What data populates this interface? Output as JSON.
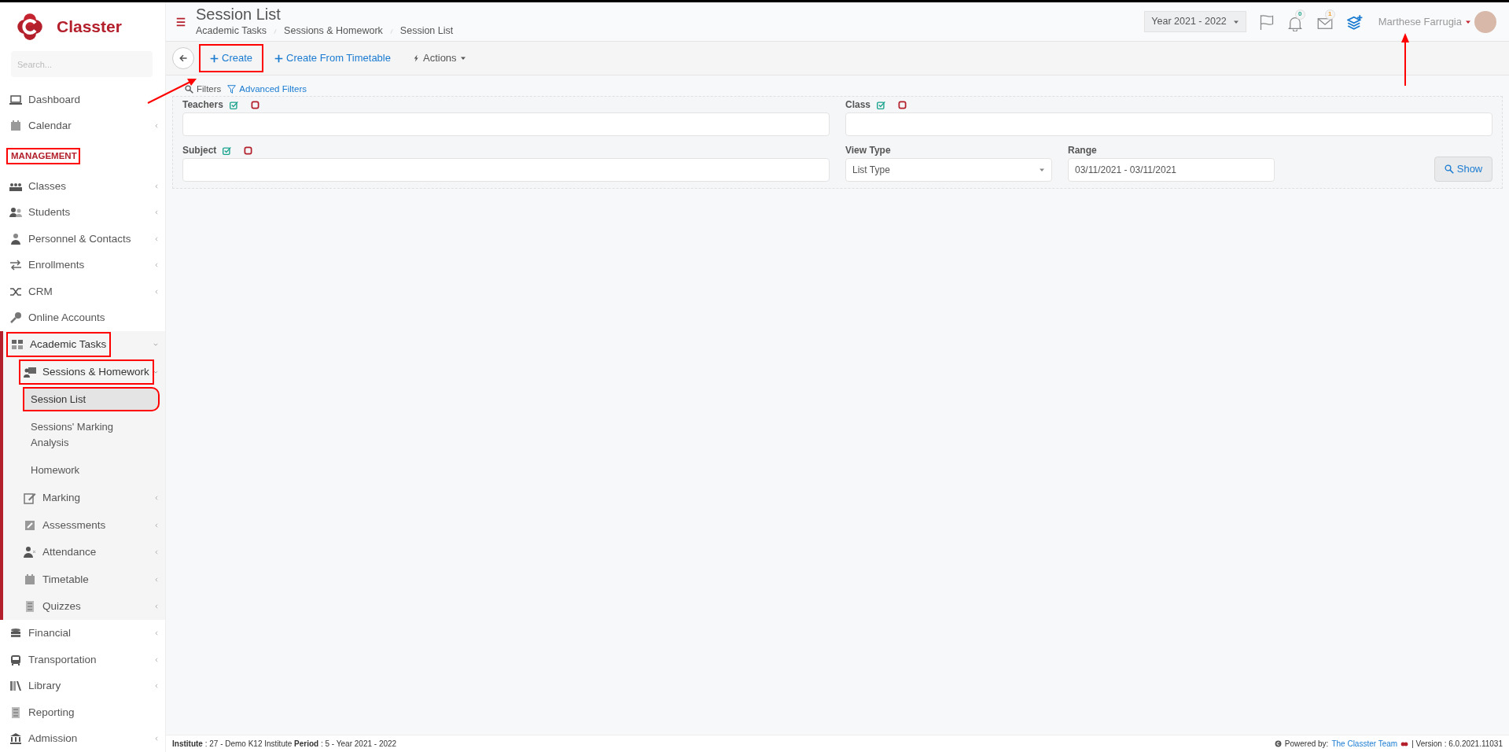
{
  "sidebar": {
    "logo": "Classter",
    "search": {
      "placeholder": "Search..."
    },
    "items": [
      {
        "kind": "item",
        "label": "Dashboard",
        "selected": false,
        "annotated": false
      },
      {
        "kind": "item",
        "label": "Calendar",
        "expanded": false,
        "selected": false,
        "annotated": false
      },
      {
        "kind": "section",
        "label": "MANAGEMENT",
        "annotated": true
      },
      {
        "kind": "item",
        "label": "Classes",
        "expanded": false,
        "selected": false,
        "annotated": false
      },
      {
        "kind": "item",
        "label": "Students",
        "expanded": false,
        "selected": false,
        "annotated": false
      },
      {
        "kind": "item",
        "label": "Personnel & Contacts",
        "expanded": false,
        "selected": false,
        "annotated": false
      },
      {
        "kind": "item",
        "label": "Enrollments",
        "expanded": false,
        "selected": false,
        "annotated": false
      },
      {
        "kind": "item",
        "label": "CRM",
        "expanded": false,
        "selected": false,
        "annotated": false
      },
      {
        "kind": "item",
        "label": "Online Accounts",
        "selected": false,
        "annotated": false
      },
      {
        "kind": "item",
        "label": "Academic Tasks",
        "expanded": true,
        "selected": false,
        "annotated": true,
        "children": [
          {
            "label": "Sessions & Homework",
            "expanded": true,
            "selected": false,
            "annotated": true,
            "children": [
              {
                "label": "Session List",
                "selected": true,
                "annotated": true
              },
              {
                "label": "Sessions' Marking Analysis",
                "selected": false,
                "annotated": false
              },
              {
                "label": "Homework",
                "selected": false,
                "annotated": false
              }
            ]
          },
          {
            "label": "Marking",
            "expanded": false,
            "selected": false,
            "annotated": false
          },
          {
            "label": "Assessments",
            "expanded": false,
            "selected": false,
            "annotated": false
          },
          {
            "label": "Attendance",
            "expanded": false,
            "selected": false,
            "annotated": false
          },
          {
            "label": "Timetable",
            "expanded": false,
            "selected": false,
            "annotated": false
          },
          {
            "label": "Quizzes",
            "expanded": false,
            "selected": false,
            "annotated": false
          }
        ]
      },
      {
        "kind": "item",
        "label": "Financial",
        "expanded": false,
        "selected": false,
        "annotated": false
      },
      {
        "kind": "item",
        "label": "Transportation",
        "expanded": false,
        "selected": false,
        "annotated": false
      },
      {
        "kind": "item",
        "label": "Library",
        "expanded": false,
        "selected": false,
        "annotated": false
      },
      {
        "kind": "item",
        "label": "Reporting",
        "selected": false,
        "annotated": false
      },
      {
        "kind": "item",
        "label": "Admission",
        "expanded": false,
        "selected": false,
        "annotated": false
      }
    ]
  },
  "header": {
    "title": "Session List",
    "breadcrumbs": [
      "Academic Tasks",
      "Sessions & Homework",
      "Session List"
    ],
    "year": "Year 2021 - 2022",
    "notifications": "0",
    "messages": "1",
    "user": "Marthese Farrugia"
  },
  "toolbar": {
    "buttons": [
      {
        "kind": "create",
        "label": "Create",
        "annotated": true
      },
      {
        "kind": "create",
        "label": "Create From Timetable",
        "annotated": false
      },
      {
        "kind": "actions",
        "label": "Actions",
        "annotated": false
      }
    ]
  },
  "filters": {
    "title": "Filters",
    "advanced": "Advanced Filters",
    "teachers": {
      "label": "Teachers"
    },
    "class": {
      "label": "Class"
    },
    "subject": {
      "label": "Subject"
    },
    "view_type": {
      "label": "View Type",
      "value": "List Type"
    },
    "range": {
      "label": "Range",
      "value": "03/11/2021 - 03/11/2021"
    },
    "show": "Show"
  },
  "footer": {
    "info": "**Institute** : 27 - Demo K12 Institute **Period** : 5 - Year 2021 - 2022",
    "powered": "Powered by:",
    "team": "The Classter Team",
    "version": "| Version : 6.0.2021.11031"
  }
}
